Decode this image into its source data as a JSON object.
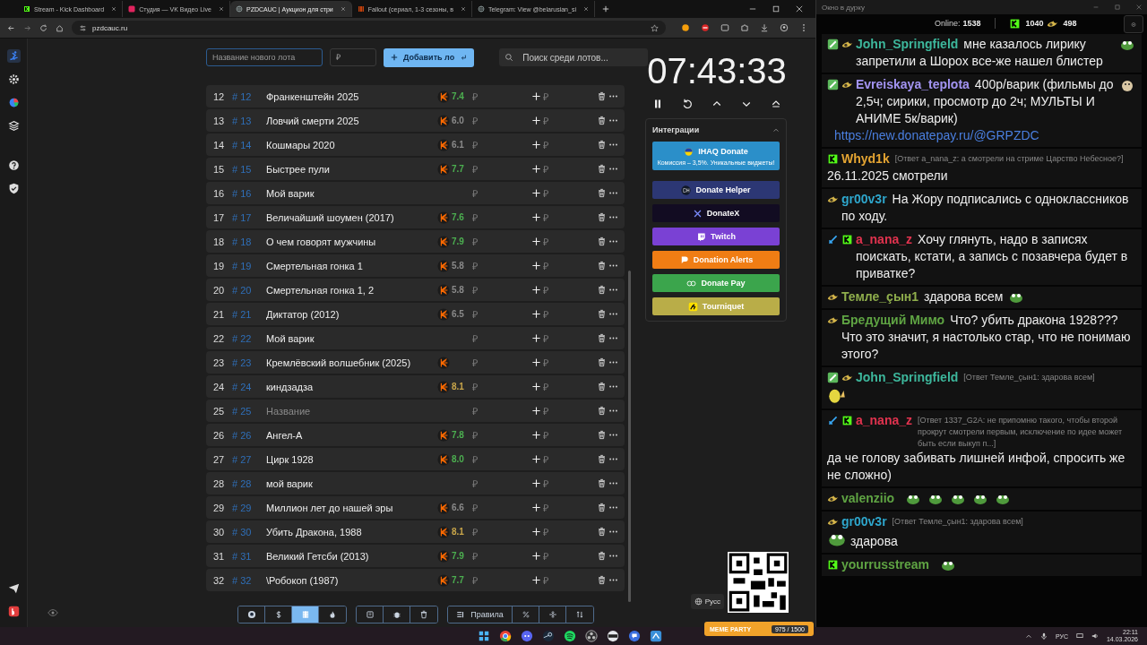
{
  "browser": {
    "tabs": [
      {
        "title": "Stream - Kick Dashboard",
        "kind": "kick",
        "selected": false
      },
      {
        "title": "Студия — VK Видео Live",
        "kind": "vk",
        "selected": false
      },
      {
        "title": "PZDCAUC | Аукцион для стри",
        "kind": "globe",
        "selected": true
      },
      {
        "title": "Fallout (сериал, 1-3 сезоны, в",
        "kind": "film",
        "selected": false
      },
      {
        "title": "Telegram: View @belarusian_si",
        "kind": "globe",
        "selected": false
      }
    ],
    "address": "pzdcauc.ru"
  },
  "sidebar": {
    "items": [
      {
        "kind": "ski",
        "selected": true
      },
      {
        "kind": "gear",
        "selected": false
      },
      {
        "kind": "pie",
        "selected": false
      },
      {
        "kind": "layers",
        "selected": false
      },
      {
        "kind": "help",
        "selected": false
      },
      {
        "kind": "shield",
        "selected": false
      }
    ]
  },
  "new_lot": {
    "name_placeholder": "Название нового лота",
    "price_placeholder": "₽",
    "add_button": "Добавить ло",
    "search_placeholder": "Поиск среди лотов..."
  },
  "lots": [
    {
      "num": "12",
      "id": "# 12",
      "title": "Франкенштейн 2025",
      "kp": true,
      "rating": {
        "value": "7.4",
        "color": "#4caf50"
      },
      "price_placeholder": "₽",
      "bid_placeholder": "₽"
    },
    {
      "num": "13",
      "id": "# 13",
      "title": "Ловчий смерти 2025",
      "kp": true,
      "rating": {
        "value": "6.0",
        "color": "#8a8a8a"
      },
      "price_placeholder": "₽",
      "bid_placeholder": "₽"
    },
    {
      "num": "14",
      "id": "# 14",
      "title": "Кошмары 2020",
      "kp": true,
      "rating": {
        "value": "6.1",
        "color": "#8a8a8a"
      },
      "price_placeholder": "₽",
      "bid_placeholder": "₽"
    },
    {
      "num": "15",
      "id": "# 15",
      "title": "Быстрее пули",
      "kp": true,
      "rating": {
        "value": "7.7",
        "color": "#4caf50"
      },
      "price_placeholder": "₽",
      "bid_placeholder": "₽"
    },
    {
      "num": "16",
      "id": "# 16",
      "title": "Мой варик",
      "kp": false,
      "price_placeholder": "₽",
      "bid_placeholder": "₽"
    },
    {
      "num": "17",
      "id": "# 17",
      "title": "Величайший шоумен (2017)",
      "kp": true,
      "rating": {
        "value": "7.6",
        "color": "#4caf50"
      },
      "price_placeholder": "₽",
      "bid_placeholder": "₽"
    },
    {
      "num": "18",
      "id": "# 18",
      "title": "О чем говорят мужчины",
      "kp": true,
      "rating": {
        "value": "7.9",
        "color": "#4caf50"
      },
      "price_placeholder": "₽",
      "bid_placeholder": "₽"
    },
    {
      "num": "19",
      "id": "# 19",
      "title": "Смертельная гонка 1",
      "kp": true,
      "rating": {
        "value": "5.8",
        "color": "#8a8a8a"
      },
      "price_placeholder": "₽",
      "bid_placeholder": "₽"
    },
    {
      "num": "20",
      "id": "# 20",
      "title": "Смертельная гонка 1, 2",
      "kp": true,
      "rating": {
        "value": "5.8",
        "color": "#8a8a8a"
      },
      "price_placeholder": "₽",
      "bid_placeholder": "₽"
    },
    {
      "num": "21",
      "id": "# 21",
      "title": "Диктатор (2012)",
      "kp": true,
      "rating": {
        "value": "6.5",
        "color": "#8a8a8a"
      },
      "price_placeholder": "₽",
      "bid_placeholder": "₽"
    },
    {
      "num": "22",
      "id": "# 22",
      "title": "Мой варик",
      "kp": false,
      "price_placeholder": "₽",
      "bid_placeholder": "₽"
    },
    {
      "num": "23",
      "id": "# 23",
      "title": "Кремлёвский волшебник (2025)",
      "kp": true,
      "price_placeholder": "₽",
      "bid_placeholder": "₽"
    },
    {
      "num": "24",
      "id": "# 24",
      "title": "киндзадза",
      "kp": true,
      "rating": {
        "value": "8.1",
        "color": "#c9a64a"
      },
      "price_placeholder": "₽",
      "bid_placeholder": "₽"
    },
    {
      "num": "25",
      "id": "# 25",
      "placeholder": "Название",
      "kp": false,
      "price_placeholder": "₽",
      "bid_placeholder": "₽"
    },
    {
      "num": "26",
      "id": "# 26",
      "title": "Ангел-А",
      "kp": true,
      "rating": {
        "value": "7.8",
        "color": "#4caf50"
      },
      "price_placeholder": "₽",
      "bid_placeholder": "₽"
    },
    {
      "num": "27",
      "id": "# 27",
      "title": "Цирк 1928",
      "kp": true,
      "rating": {
        "value": "8.0",
        "color": "#4caf50"
      },
      "price_placeholder": "₽",
      "bid_placeholder": "₽"
    },
    {
      "num": "28",
      "id": "# 28",
      "title": "мой варик",
      "kp": false,
      "price_placeholder": "₽",
      "bid_placeholder": "₽"
    },
    {
      "num": "29",
      "id": "# 29",
      "title": "Миллион лет до нашей эры",
      "kp": true,
      "rating": {
        "value": "6.6",
        "color": "#8a8a8a"
      },
      "price_placeholder": "₽",
      "bid_placeholder": "₽"
    },
    {
      "num": "30",
      "id": "# 30",
      "title": "Убить Дракона, 1988",
      "kp": true,
      "rating": {
        "value": "8.1",
        "color": "#c9a64a"
      },
      "price_placeholder": "₽",
      "bid_placeholder": "₽"
    },
    {
      "num": "31",
      "id": "# 31",
      "title": "Великий Гетсби (2013)",
      "kp": true,
      "rating": {
        "value": "7.9",
        "color": "#4caf50"
      },
      "price_placeholder": "₽",
      "bid_placeholder": "₽"
    },
    {
      "num": "32",
      "id": "# 32",
      "title": "\\Робокоп (1987)",
      "kp": true,
      "rating": {
        "value": "7.7",
        "color": "#4caf50"
      },
      "price_placeholder": "₽",
      "bid_placeholder": "₽"
    }
  ],
  "toolbar": {
    "groups": [
      [
        {
          "kind": "github",
          "selected": false
        },
        {
          "kind": "dollar",
          "selected": false
        },
        {
          "kind": "film",
          "selected": true
        },
        {
          "kind": "fire",
          "selected": false
        }
      ],
      [
        {
          "kind": "save",
          "selected": false
        },
        {
          "kind": "bug",
          "selected": false
        },
        {
          "kind": "trash",
          "selected": false
        }
      ],
      [
        {
          "kind": "list",
          "label": "Правила",
          "selected": false
        },
        {
          "kind": "percent",
          "selected": false
        },
        {
          "kind": "split",
          "selected": false
        },
        {
          "kind": "sort",
          "selected": false
        }
      ]
    ]
  },
  "language": "Русс",
  "timer": {
    "time": "07:43:33"
  },
  "integrations": {
    "title": "Интеграции",
    "expanded": true,
    "items": [
      {
        "kind": "ihaq",
        "label": "IHAQ Donate",
        "subtitle": "Комиссия – 3,5%. Уникальные виджеты!",
        "color": "#2b8fc9"
      },
      {
        "kind": "helper",
        "label": "Donate Helper",
        "color": "#2c3774"
      },
      {
        "kind": "x",
        "label": "DonateX",
        "color": "#120c22"
      },
      {
        "kind": "twitch",
        "label": "Twitch",
        "color": "#7a41d4"
      },
      {
        "kind": "alerts",
        "label": "Donation Alerts",
        "color": "#f07d14"
      },
      {
        "kind": "pay",
        "label": "Donate Pay",
        "color": "#3ba54c"
      },
      {
        "kind": "tourniquet",
        "label": "Tourniquet",
        "color": "#b9ad48"
      }
    ]
  },
  "meme_party": {
    "title": "MEME PARTY",
    "count": "975 / 1500"
  },
  "chat": {
    "window_title": "Окно в дурку",
    "online_label": "Online:",
    "online_count": "1538",
    "kick_count": "1040",
    "crown_count": "498",
    "messages": [
      {
        "badges": [
          {
            "kind": "sub"
          },
          {
            "kind": "crown"
          }
        ],
        "user": "John_Springfield",
        "color": "#3db79c",
        "text": "мне казалось лирику запретили а Шорох все-же нашел блистер",
        "emotes": [
          {
            "kind": "frog"
          }
        ]
      },
      {
        "badges": [
          {
            "kind": "sub"
          },
          {
            "kind": "crown"
          }
        ],
        "user": "Evreiskaya_teplota",
        "color": "#a394f2",
        "text": "400р/варик (фильмы до 2,5ч; сирики, просмотр до 2ч; МУЛЬТЫ И АНИМЕ 5к/варик)",
        "emotes": [
          {
            "kind": "hamster"
          }
        ],
        "link": "https://new.donatepay.ru/@GRPZDC"
      },
      {
        "badges": [
          {
            "kind": "kick"
          }
        ],
        "user": "Whyd1k",
        "color": "#e4a432",
        "reply": "[Ответ a_nana_z: а смотрели на стриме Царство Небесное?]",
        "text": "26.11.2025 смотрели"
      },
      {
        "badges": [
          {
            "kind": "crown"
          }
        ],
        "user": "gr00v3r",
        "color": "#2ea6cc",
        "text": "На Жору подписались с одноклассников по ходу."
      },
      {
        "badges": [
          {
            "kind": "sword"
          },
          {
            "kind": "kick"
          }
        ],
        "user": "a_nana_z",
        "color": "#e2334f",
        "text": "Хочу глянуть, надо в записях поискать, кстати, а запись с позавчера будет в приватке?"
      },
      {
        "badges": [
          {
            "kind": "crown"
          }
        ],
        "user": "Темле_çын1",
        "color": "#8fae4c",
        "text": "здарова всем",
        "emotes": [
          {
            "kind": "frog"
          }
        ]
      },
      {
        "badges": [
          {
            "kind": "crown"
          }
        ],
        "user": "Бредущий Мимо",
        "color": "#5fa443",
        "text": "Что? убить дракона 1928??? Что это значит, я настолько стар, что не понимаю этого?"
      },
      {
        "badges": [
          {
            "kind": "sub"
          },
          {
            "kind": "crown"
          }
        ],
        "user": "John_Springfield",
        "color": "#3db79c",
        "reply": "[Ответ Темле_çын1: здарова всем]",
        "emotes": [
          {
            "kind": "face"
          }
        ]
      },
      {
        "badges": [
          {
            "kind": "sword"
          },
          {
            "kind": "kick"
          }
        ],
        "user": "a_nana_z",
        "color": "#e2334f",
        "reply": "[Ответ 1337_G2A: не припомню такого, чтобы второй прокрут смотрели первым, исключение по идее может быть если выкуп п...]",
        "text": "да че голову забивать лишней инфой, спросить же не сложно)"
      },
      {
        "badges": [
          {
            "kind": "crown"
          }
        ],
        "user": "valenziio",
        "color": "#5fa443",
        "emotes": [
          {
            "kind": "frog"
          },
          {
            "kind": "frog"
          },
          {
            "kind": "frog"
          },
          {
            "kind": "frog"
          },
          {
            "kind": "frog"
          }
        ]
      },
      {
        "badges": [
          {
            "kind": "crown"
          }
        ],
        "user": "gr00v3r",
        "color": "#2ea6cc",
        "reply": "[Ответ Темле_çын1: здарова всем]",
        "emotes": [
          {
            "kind": "frog"
          }
        ],
        "text": "здарова"
      },
      {
        "badges": [
          {
            "kind": "kick"
          }
        ],
        "user": "yourrusstream",
        "color": "#5fa443",
        "emotes": [
          {
            "kind": "frog"
          }
        ]
      }
    ]
  },
  "taskbar": {
    "apps": [
      {
        "kind": "windows"
      },
      {
        "kind": "chrome"
      },
      {
        "kind": "discord"
      },
      {
        "kind": "steam"
      },
      {
        "kind": "spotify"
      },
      {
        "kind": "obs"
      },
      {
        "kind": "disc"
      },
      {
        "kind": "chat"
      },
      {
        "kind": "app"
      }
    ],
    "language": "РУС",
    "time": "22:11",
    "date": "14.03.2026"
  }
}
